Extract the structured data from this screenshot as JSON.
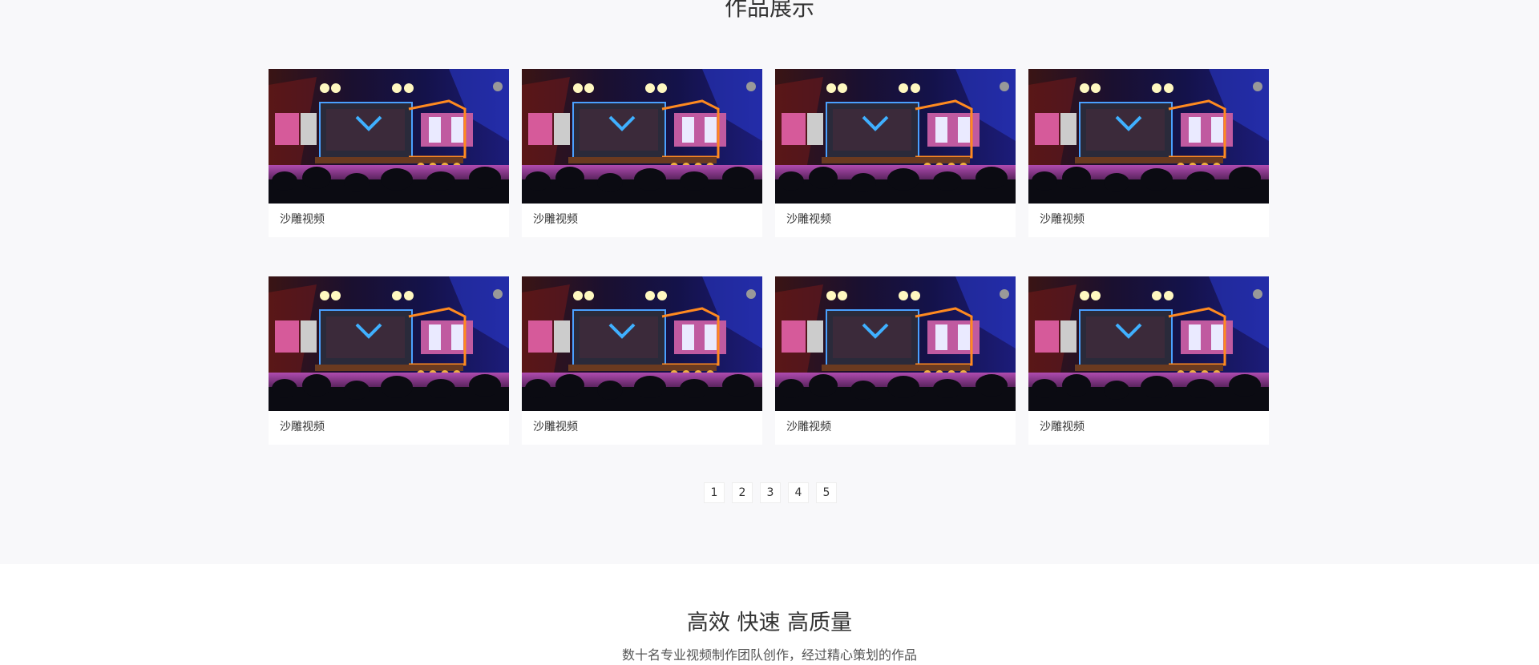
{
  "portfolio": {
    "title": "作品展示",
    "items": [
      {
        "caption": "沙雕视频"
      },
      {
        "caption": "沙雕视频"
      },
      {
        "caption": "沙雕视频"
      },
      {
        "caption": "沙雕视频"
      },
      {
        "caption": "沙雕视频"
      },
      {
        "caption": "沙雕视频"
      },
      {
        "caption": "沙雕视频"
      },
      {
        "caption": "沙雕视频"
      }
    ],
    "pagination": [
      "1",
      "2",
      "3",
      "4",
      "5"
    ]
  },
  "features": {
    "title": "高效 快速 高质量",
    "subtitle": "数十名专业视频制作团队创作，经过精心策划的作品"
  }
}
